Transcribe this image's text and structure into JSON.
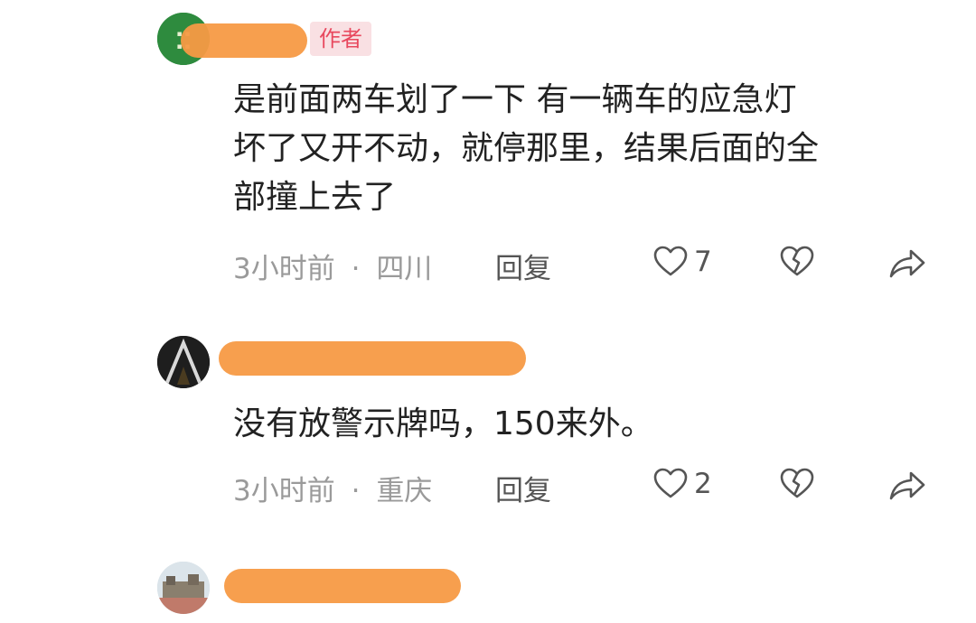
{
  "comments": [
    {
      "author_badge": "作者",
      "body_lines": [
        "是前面两车划了一下  有一辆车的应急灯",
        "坏了又开不动，就停那里，结果后面的全",
        "部撞上去了"
      ],
      "time": "3小时前",
      "location": "四川",
      "reply_label": "回复",
      "likes": "7"
    },
    {
      "body_lines": [
        "没有放警示牌吗，150来外。"
      ],
      "time": "3小时前",
      "location": "重庆",
      "reply_label": "回复",
      "likes": "2"
    },
    {}
  ],
  "colors": {
    "redaction": "#f79a45",
    "badge_bg": "#f9e0e3",
    "badge_text": "#e8485e",
    "meta_text": "#9a9a9a"
  },
  "icons": [
    "heart-outline-icon",
    "broken-heart-icon",
    "share-arrow-icon"
  ],
  "separator": "·"
}
